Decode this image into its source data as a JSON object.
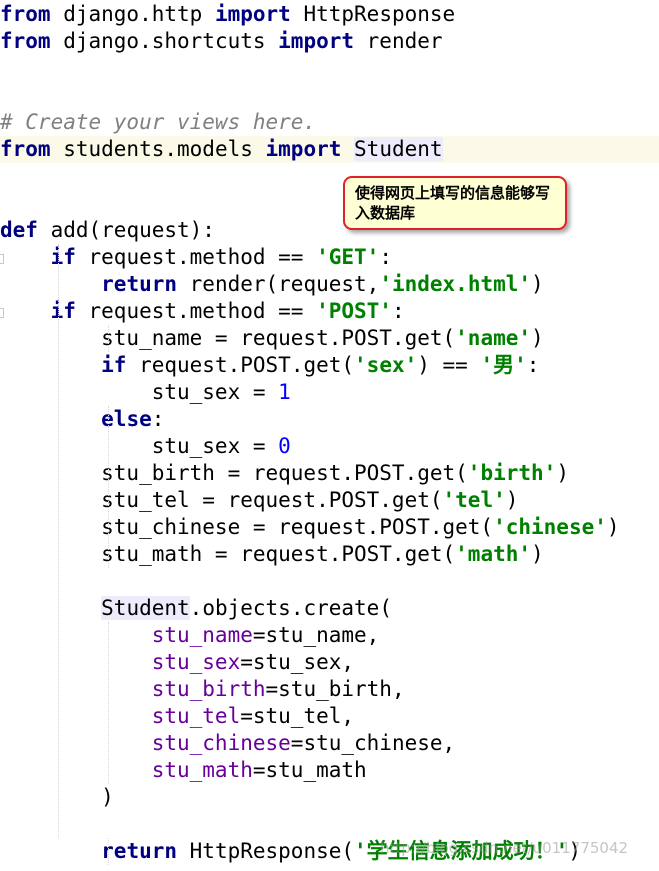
{
  "editor": {
    "lines": [
      [
        {
          "t": "from",
          "c": "kw"
        },
        {
          "t": " django.http "
        },
        {
          "t": "import",
          "c": "kw"
        },
        {
          "t": " HttpResponse"
        }
      ],
      [
        {
          "t": "from",
          "c": "kw"
        },
        {
          "t": " django.shortcuts "
        },
        {
          "t": "import",
          "c": "kw"
        },
        {
          "t": " render"
        }
      ],
      [],
      [],
      [
        {
          "t": "# Create your views here.",
          "c": "cmt"
        }
      ],
      [
        {
          "t": "from",
          "c": "kw"
        },
        {
          "t": " students.models "
        },
        {
          "t": "import",
          "c": "kw"
        },
        {
          "t": " "
        },
        {
          "t": "Student",
          "c": "cls"
        }
      ],
      [],
      [],
      [
        {
          "t": "def",
          "c": "kw"
        },
        {
          "t": " add(request):"
        }
      ],
      [
        {
          "t": "    "
        },
        {
          "t": "if",
          "c": "kw"
        },
        {
          "t": " request.method == "
        },
        {
          "t": "'GET'",
          "c": "str"
        },
        {
          "t": ":"
        }
      ],
      [
        {
          "t": "        "
        },
        {
          "t": "return",
          "c": "kw"
        },
        {
          "t": " render(request,"
        },
        {
          "t": "'index.html'",
          "c": "str"
        },
        {
          "t": ")"
        }
      ],
      [
        {
          "t": "    "
        },
        {
          "t": "if",
          "c": "kw"
        },
        {
          "t": " request.method == "
        },
        {
          "t": "'POST'",
          "c": "str"
        },
        {
          "t": ":"
        }
      ],
      [
        {
          "t": "        stu_name = request.POST.get("
        },
        {
          "t": "'name'",
          "c": "str"
        },
        {
          "t": ")"
        }
      ],
      [
        {
          "t": "        "
        },
        {
          "t": "if",
          "c": "kw"
        },
        {
          "t": " request.POST.get("
        },
        {
          "t": "'sex'",
          "c": "str"
        },
        {
          "t": ") == "
        },
        {
          "t": "'男'",
          "c": "str"
        },
        {
          "t": ":"
        }
      ],
      [
        {
          "t": "            stu_sex = "
        },
        {
          "t": "1",
          "c": "num"
        }
      ],
      [
        {
          "t": "        "
        },
        {
          "t": "else",
          "c": "kw"
        },
        {
          "t": ":"
        }
      ],
      [
        {
          "t": "            stu_sex = "
        },
        {
          "t": "0",
          "c": "num"
        }
      ],
      [
        {
          "t": "        stu_birth = request.POST.get("
        },
        {
          "t": "'birth'",
          "c": "str"
        },
        {
          "t": ")"
        }
      ],
      [
        {
          "t": "        stu_tel = request.POST.get("
        },
        {
          "t": "'tel'",
          "c": "str"
        },
        {
          "t": ")"
        }
      ],
      [
        {
          "t": "        stu_chinese = request.POST.get("
        },
        {
          "t": "'chinese'",
          "c": "str"
        },
        {
          "t": ")"
        }
      ],
      [
        {
          "t": "        stu_math = request.POST.get("
        },
        {
          "t": "'math'",
          "c": "str"
        },
        {
          "t": ")"
        }
      ],
      [],
      [
        {
          "t": "        "
        },
        {
          "t": "Student",
          "c": "cls"
        },
        {
          "t": ".objects.create("
        }
      ],
      [
        {
          "t": "            "
        },
        {
          "t": "stu_name",
          "c": "kwarg"
        },
        {
          "t": "=stu_name,"
        }
      ],
      [
        {
          "t": "            "
        },
        {
          "t": "stu_sex",
          "c": "kwarg"
        },
        {
          "t": "=stu_sex,"
        }
      ],
      [
        {
          "t": "            "
        },
        {
          "t": "stu_birth",
          "c": "kwarg"
        },
        {
          "t": "=stu_birth,"
        }
      ],
      [
        {
          "t": "            "
        },
        {
          "t": "stu_tel",
          "c": "kwarg"
        },
        {
          "t": "=stu_tel,"
        }
      ],
      [
        {
          "t": "            "
        },
        {
          "t": "stu_chinese",
          "c": "kwarg"
        },
        {
          "t": "=stu_chinese,"
        }
      ],
      [
        {
          "t": "            "
        },
        {
          "t": "stu_math",
          "c": "kwarg"
        },
        {
          "t": "=stu_math"
        }
      ],
      [
        {
          "t": "        )"
        }
      ],
      [],
      [
        {
          "t": "        "
        },
        {
          "t": "return",
          "c": "kw"
        },
        {
          "t": " HttpResponse("
        },
        {
          "t": "'学生信息添加成功！'",
          "c": "str"
        },
        {
          "t": ")"
        }
      ]
    ],
    "highlighted_line": 5
  },
  "note": {
    "text": "使得网页上填写的信息能够写入数据库"
  },
  "watermark": {
    "text": "http://blog.csdn.net/u011775042"
  },
  "colors": {
    "keyword": "#000080",
    "string": "#008000",
    "number": "#0000ff",
    "comment": "#808080",
    "keyword_argument": "#660099",
    "note_border": "#e0202a",
    "note_fill": "#ffffd4",
    "current_line": "#fbf9e8"
  }
}
